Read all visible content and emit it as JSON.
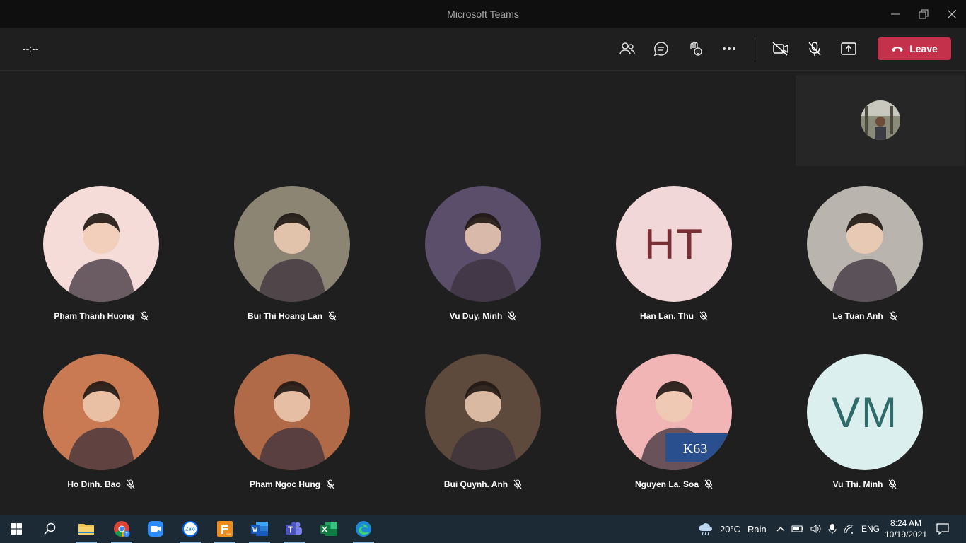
{
  "window": {
    "title": "Microsoft Teams"
  },
  "meeting": {
    "timer": "--:--",
    "leave_label": "Leave"
  },
  "participants": [
    {
      "name": "Pham Thanh Huong",
      "type": "photo",
      "photo_bg": "#f5dcd9"
    },
    {
      "name": "Bui Thi Hoang Lan",
      "type": "photo",
      "photo_bg": "#8c8574"
    },
    {
      "name": "Vu Duy. Minh",
      "type": "photo",
      "photo_bg": "#5a4e6a"
    },
    {
      "name": "Han Lan. Thu",
      "type": "initials",
      "initials": "HT",
      "bg": "#f2d7d9",
      "fg": "#7a2e36"
    },
    {
      "name": "Le Tuan Anh",
      "type": "photo",
      "photo_bg": "#b9b5ae"
    },
    {
      "name": "Ho Dinh. Bao",
      "type": "photo",
      "photo_bg": "#c97a52"
    },
    {
      "name": "Pham Ngoc Hung",
      "type": "photo",
      "photo_bg": "#b06a48"
    },
    {
      "name": "Bui Quynh. Anh",
      "type": "photo",
      "photo_bg": "#5d4a3c"
    },
    {
      "name": "Nguyen La. Soa",
      "type": "photo",
      "photo_bg": "#f1b5b5",
      "photo_text": "K63"
    },
    {
      "name": "Vu Thi. Minh",
      "type": "initials",
      "initials": "VM",
      "bg": "#dcefef",
      "fg": "#2f6b6b"
    }
  ],
  "taskbar": {
    "weather": {
      "temp": "20°C",
      "condition": "Rain"
    },
    "language": "ENG",
    "time": "8:24 AM",
    "date": "10/19/2021",
    "apps": [
      "file-explorer",
      "chrome",
      "zoom",
      "zalo",
      "foxit-pdf",
      "word",
      "teams",
      "excel",
      "edge"
    ],
    "zalo_label": "Zalo",
    "pdf_label": "PDF"
  },
  "colors": {
    "leave": "#c4314b",
    "background": "#1f1f1f",
    "taskbar": "#1b2a34"
  }
}
